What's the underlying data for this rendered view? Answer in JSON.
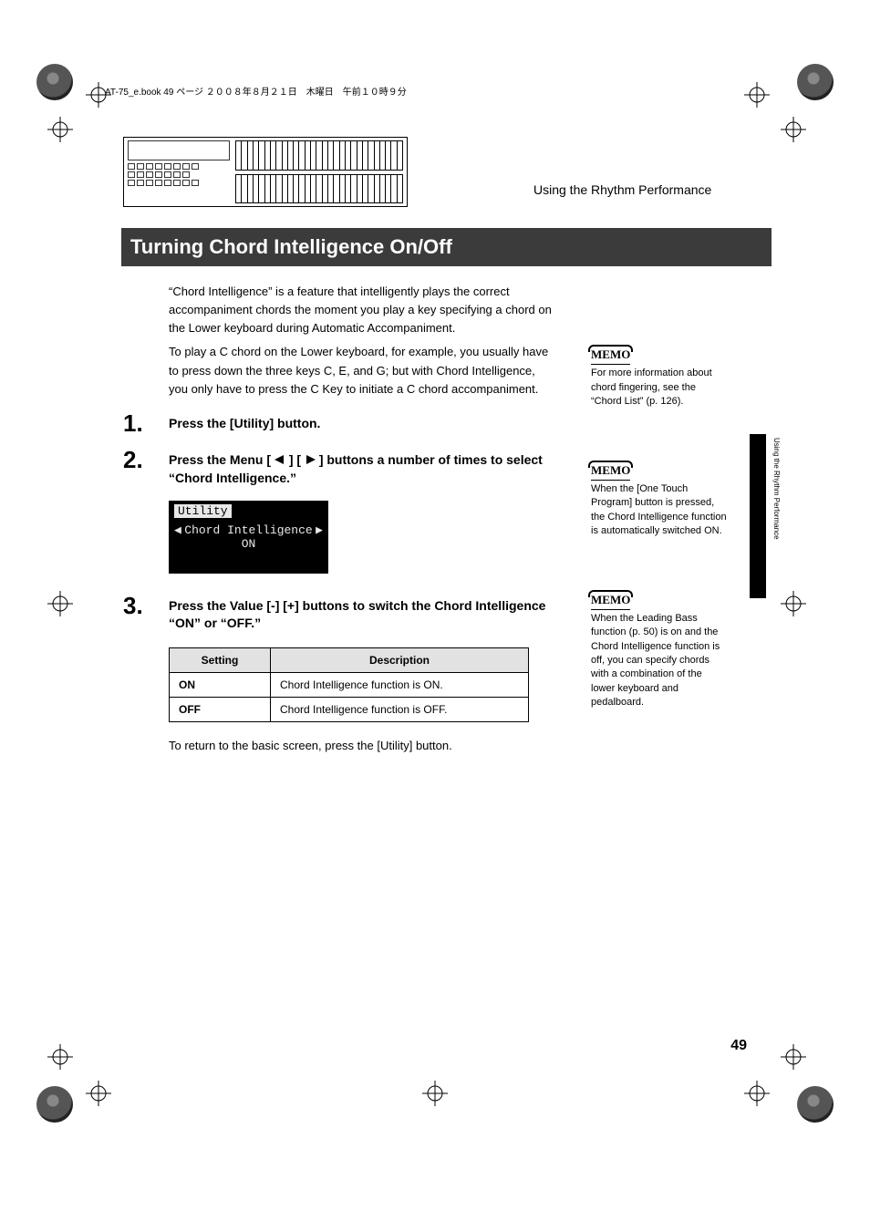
{
  "file_header": "AT-75_e.book  49 ページ  ２００８年８月２１日　木曜日　午前１０時９分",
  "section_header": "Using the Rhythm Performance",
  "title": "Turning Chord Intelligence On/Off",
  "intro_p1": "“Chord Intelligence” is a feature that intelligently plays the correct accompaniment chords the moment you play a key specifying a chord on the Lower keyboard during Automatic Accompaniment.",
  "intro_p2": "To play a C chord on the Lower keyboard, for example, you usually have to press down the three keys C, E, and G; but with Chord Intelligence, you only have to press the C Key to initiate a C chord accompaniment.",
  "steps": {
    "s1_num": "1.",
    "s1_body": "Press the [Utility] button.",
    "s2_num": "2.",
    "s2_body_a": "Press the Menu [",
    "s2_body_mid": "] [",
    "s2_body_b": "] buttons a number of times to select “Chord Intelligence.”",
    "s3_num": "3.",
    "s3_body": "Press the Value [-] [+] buttons to switch the Chord Intelligence “ON” or “OFF.”"
  },
  "lcd": {
    "title": "Utility",
    "line2": "Chord Intelligence",
    "line3": "ON"
  },
  "table": {
    "h1": "Setting",
    "h2": "Description",
    "r1c1": "ON",
    "r1c2": "Chord Intelligence function is ON.",
    "r2c1": "OFF",
    "r2c2": "Chord Intelligence function is OFF."
  },
  "after_table": "To return to the basic screen, press the [Utility] button.",
  "memos": {
    "label": "MEMO",
    "m1": "For more information about chord fingering, see the “Chord List” (p. 126).",
    "m2": "When the [One Touch Program] button is pressed, the Chord Intelligence function is automatically switched ON.",
    "m3": "When the Leading Bass function (p. 50) is on and the Chord Intelligence function is off, you can specify chords with a combination of the lower keyboard and pedalboard."
  },
  "side_tab_text": "Using the Rhythm Performance",
  "page_number": "49"
}
